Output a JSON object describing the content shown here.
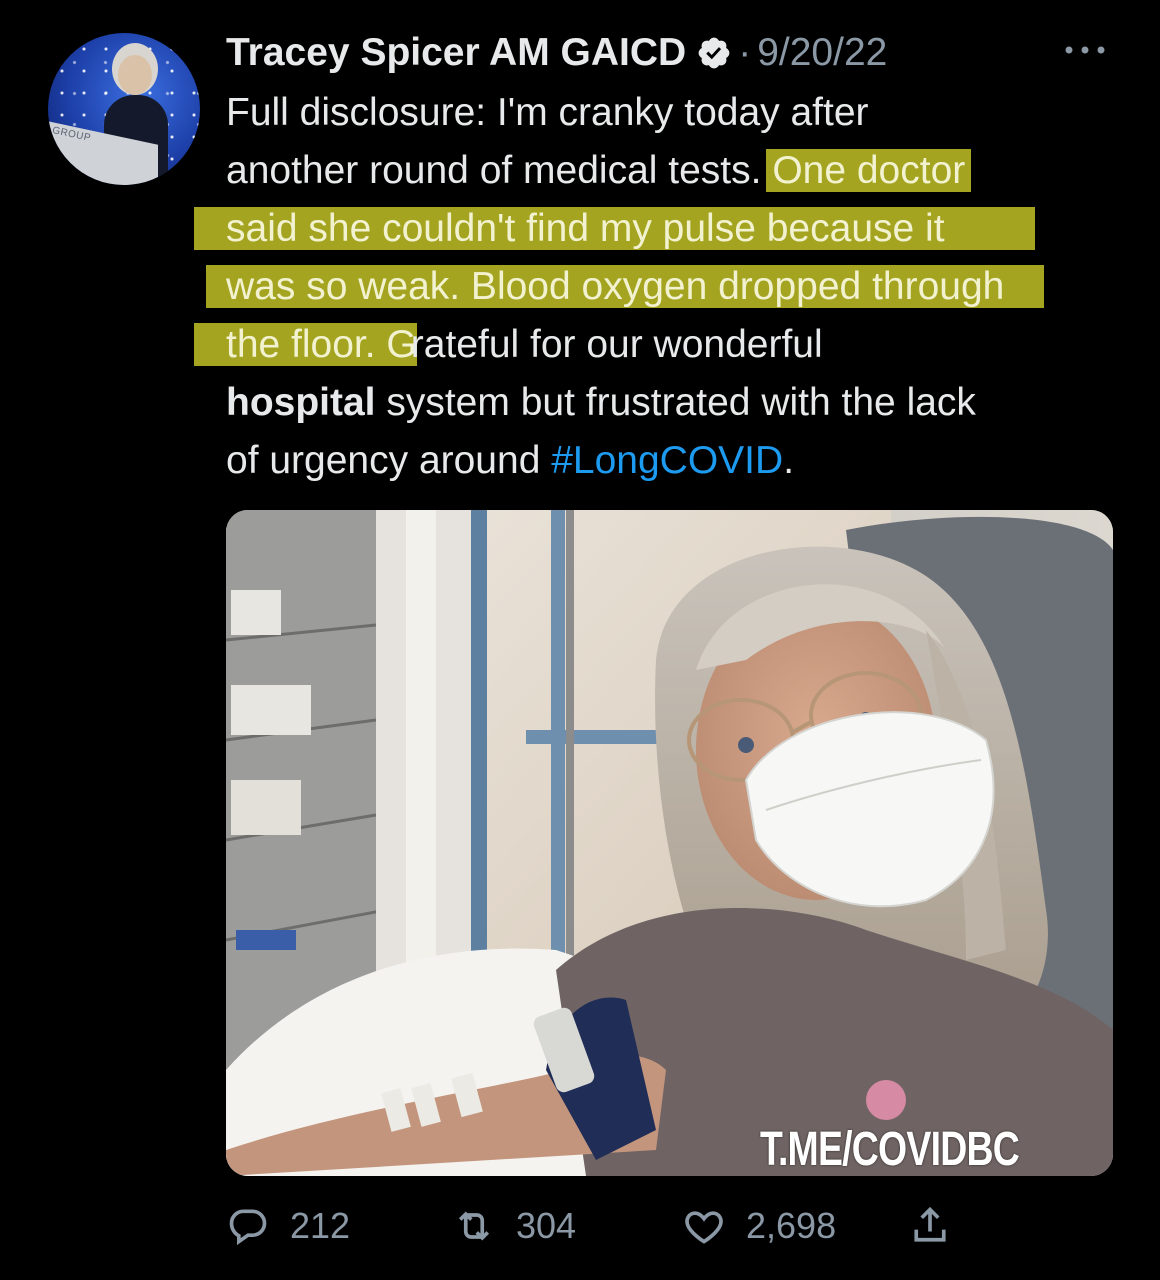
{
  "tweet": {
    "display_name": "Tracey Spicer AM GAICD",
    "separator": "·",
    "date": "9/20/22",
    "avatar_podium_text": "GROUP",
    "body": {
      "line1": "Full disclosure: I'm cranky today after",
      "line2_plain": "another round of medical tests. ",
      "line2_hl": "One doctor",
      "line3_hl": "said she couldn't find my pulse because it",
      "line4_hl": "was so weak. Blood oxygen dropped through",
      "line5_hl": "the floor. G",
      "line5_plain": "rateful for our wonderful",
      "line6_bold": "hospital",
      "line6_plain": " system but frustrated with the lack",
      "line7_plain": "of urgency around ",
      "line7_hashtag": "#LongCOVID",
      "line7_end": "."
    },
    "media": {
      "watermark": "T.ME/COVIDBC"
    },
    "actions": {
      "replies": "212",
      "retweets": "304",
      "likes": "2,698"
    }
  },
  "colors": {
    "background": "#000000",
    "text": "#e7e9ea",
    "muted": "#8b98a5",
    "link": "#1d9bf0",
    "highlight": "#c8c828"
  },
  "icons": {
    "verified": "verified-badge-icon",
    "more": "more-dots-icon",
    "reply": "reply-icon",
    "retweet": "retweet-icon",
    "like": "heart-icon",
    "share": "share-icon"
  }
}
